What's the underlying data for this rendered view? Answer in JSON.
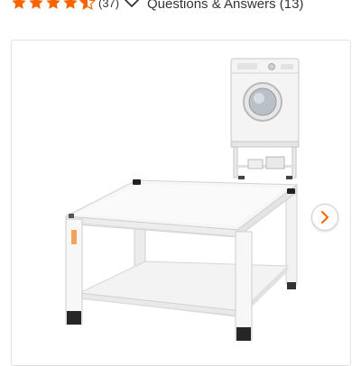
{
  "rating": {
    "value": 4.5,
    "max": 5,
    "count_label": "(37)"
  },
  "questions": {
    "label": "Questions & Answers (13)"
  },
  "icons": {
    "star": "star-icon",
    "chevron": "chevron-down-icon",
    "next": "chevron-right-icon"
  },
  "colors": {
    "star": "#f96302",
    "next_arrow": "#f96302",
    "text": "#333333"
  }
}
